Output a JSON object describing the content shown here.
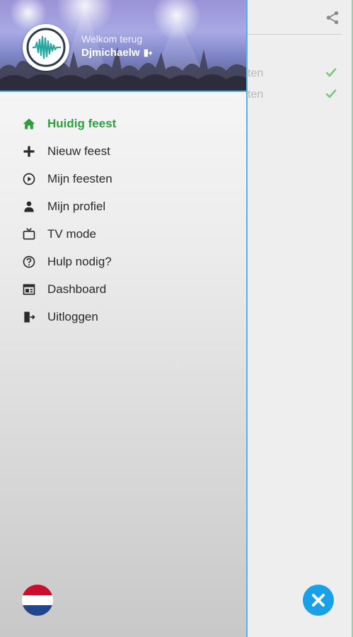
{
  "header": {
    "welcome_text": "Welkom terug",
    "username": "Djmichaelw"
  },
  "menu": {
    "items": [
      {
        "label": "Huidig feest",
        "icon": "home-icon",
        "active": true
      },
      {
        "label": "Nieuw feest",
        "icon": "plus-icon",
        "active": false
      },
      {
        "label": "Mijn feesten",
        "icon": "play-circle-icon",
        "active": false
      },
      {
        "label": "Mijn profiel",
        "icon": "person-icon",
        "active": false
      },
      {
        "label": "TV mode",
        "icon": "tv-icon",
        "active": false
      },
      {
        "label": "Hulp nodig?",
        "icon": "help-circle-icon",
        "active": false
      },
      {
        "label": "Dashboard",
        "icon": "dashboard-icon",
        "active": false
      },
      {
        "label": "Uitloggen",
        "icon": "logout-icon",
        "active": false
      }
    ]
  },
  "background_screen": {
    "rows": [
      {
        "text": "ten",
        "status": "check-icon"
      },
      {
        "text": "ten",
        "status": "check-icon"
      }
    ]
  },
  "language_flag": "netherlands-flag",
  "colors": {
    "accent_green": "#2e9e3f",
    "accent_blue": "#1aa0e6",
    "check_green": "#7cc47c"
  }
}
